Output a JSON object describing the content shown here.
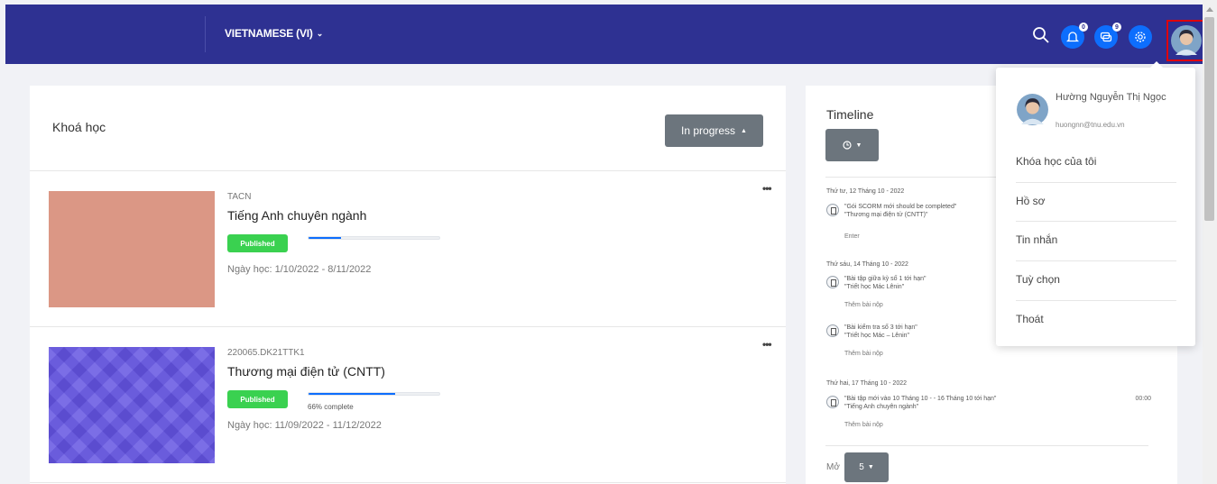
{
  "header": {
    "language_label": "VIETNAMESE (VI)",
    "notification_badge": "0",
    "message_badge": "9"
  },
  "courses": {
    "title": "Khoá học",
    "filter_label": "In progress",
    "items": [
      {
        "code": "TACN",
        "name": "Tiếng Anh chuyên ngành",
        "status": "Published",
        "progress_pct": 25,
        "progress_label": "",
        "dates": "Ngày học: 1/10/2022 - 8/11/2022",
        "thumb_color": "#db9785"
      },
      {
        "code": "220065.DK21TTK1",
        "name": "Thương mại điện tử (CNTT)",
        "status": "Published",
        "progress_pct": 66,
        "progress_label": "66% complete",
        "dates": "Ngày học: 11/09/2022 - 11/12/2022",
        "thumb_color": "#6a5cdc"
      }
    ]
  },
  "timeline": {
    "title": "Timeline",
    "groups": [
      {
        "date": "Thứ tư, 12 Tháng 10 - 2022",
        "items": [
          {
            "line1": "\"Gói SCORM mới should be completed\"",
            "line2": "\"Thương mại điện tử (CNTT)\"",
            "action": "Enter",
            "time": ""
          }
        ]
      },
      {
        "date": "Thứ sáu, 14 Tháng 10 - 2022",
        "items": [
          {
            "line1": "\"Bài tập giữa kỳ số 1 tới hạn\"",
            "line2": "\"Triết học Mác Lênin\"",
            "action": "Thêm bài nộp",
            "time": ""
          },
          {
            "line1": "\"Bài kiểm tra số 3 tới hạn\"",
            "line2": "\"Triết học Mác – Lênin\"",
            "action": "Thêm bài nộp",
            "time": ""
          }
        ]
      },
      {
        "date": "Thứ hai, 17 Tháng 10 - 2022",
        "items": [
          {
            "line1": "\"Bài tập mới vào 10 Tháng 10 - - 16 Tháng 10 tới hạn\"",
            "line2": "\"Tiếng Anh chuyên ngành\"",
            "action": "Thêm bài nộp",
            "time": "00:00"
          }
        ]
      }
    ],
    "more_label": "Mở",
    "count_value": "5"
  },
  "user_menu": {
    "name": "Hường Nguyễn Thị Ngọc",
    "email": "huongnn@tnu.edu.vn",
    "items": [
      "Khóa học của tôi",
      "Hồ sơ",
      "Tin nhắn",
      "Tuỳ chọn",
      "Thoát"
    ]
  },
  "colors": {
    "header_bg": "#2e3192",
    "accent": "#0d6efd",
    "published": "#3ad150",
    "button_gray": "#6c757d",
    "highlight_border": "#e00000"
  }
}
